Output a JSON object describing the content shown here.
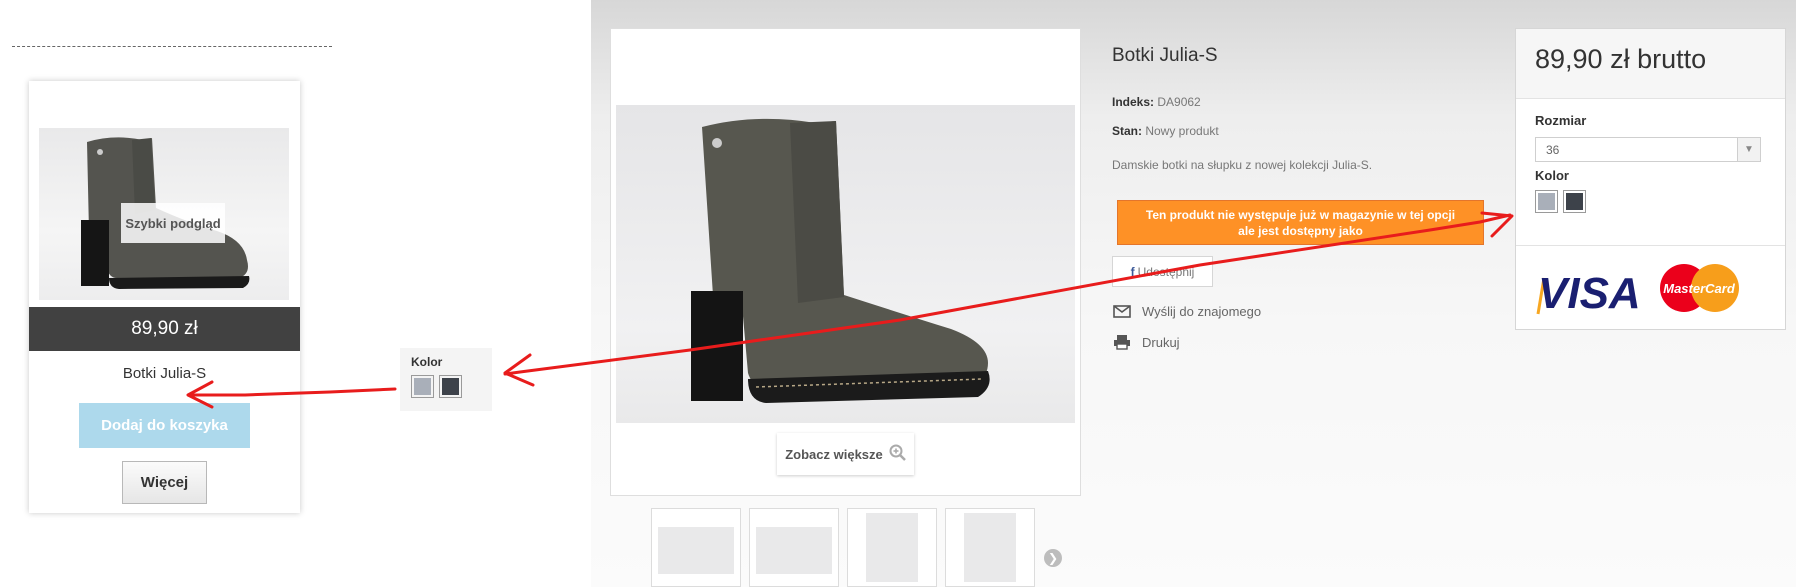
{
  "card": {
    "quick_view": "Szybki podgląd",
    "price": "89,90 zł",
    "name": "Botki Julia-S",
    "add_to_cart": "Dodaj do koszyka",
    "more": "Więcej"
  },
  "color_popup": {
    "label": "Kolor",
    "swatches": [
      "#a9afb9",
      "#3d424a"
    ]
  },
  "product": {
    "zoom": "Zobacz większe",
    "title": "Botki Julia-S",
    "index_label": "Indeks:",
    "index_value": "DA9062",
    "condition_label": "Stan:",
    "condition_value": "Nowy produkt",
    "description": "Damskie botki na słupku z nowej kolekcji Julia-S.",
    "stock_alert_line1": "Ten produkt nie występuje już w magazynie w tej opcji",
    "stock_alert_line2": "ale jest dostępny jako",
    "share": "Udostępnij",
    "share_icon": "f",
    "send_friend": "Wyślij do znajomego",
    "print": "Drukuj"
  },
  "buy_box": {
    "price": "89,90 zł brutto",
    "size_label": "Rozmiar",
    "size_value": "36",
    "color_label": "Kolor",
    "visa": "VISA",
    "mastercard": "MasterCard"
  },
  "colors": {
    "stock_alert": "#fe9126",
    "price_bar": "#414141",
    "add_button": "#add9ec",
    "arrow_red": "#e81c1c",
    "boot": "#54544f"
  },
  "icons": [
    "search-plus-icon",
    "envelope-icon",
    "printer-icon",
    "chevron-right-icon",
    "chevron-down-icon",
    "facebook-icon"
  ]
}
